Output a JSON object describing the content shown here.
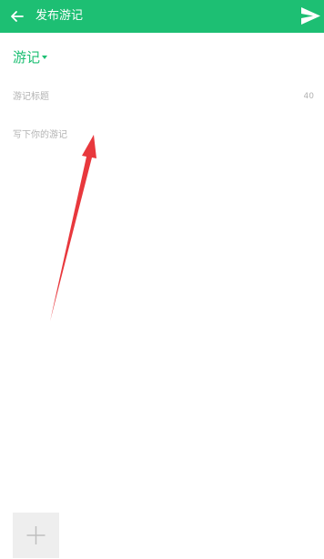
{
  "header": {
    "back_icon": "arrow-left-icon",
    "title": "发布游记",
    "send_icon": "send-icon",
    "background_color": "#1dbf73"
  },
  "form": {
    "type_selector": {
      "selected": "游记",
      "icon": "caret-down-icon"
    },
    "title_field": {
      "placeholder": "游记标题",
      "value": "",
      "max_length_indicator": "40"
    },
    "content_field": {
      "placeholder": "写下你的游记",
      "value": ""
    },
    "add_image_button": {
      "icon": "plus-icon"
    }
  },
  "annotation": {
    "icon": "red-arrow-annotation",
    "color": "#e8383d"
  },
  "colors": {
    "accent": "#1dbf73",
    "placeholder": "#b3b3b3",
    "add_tile_bg": "#eeeeee"
  }
}
